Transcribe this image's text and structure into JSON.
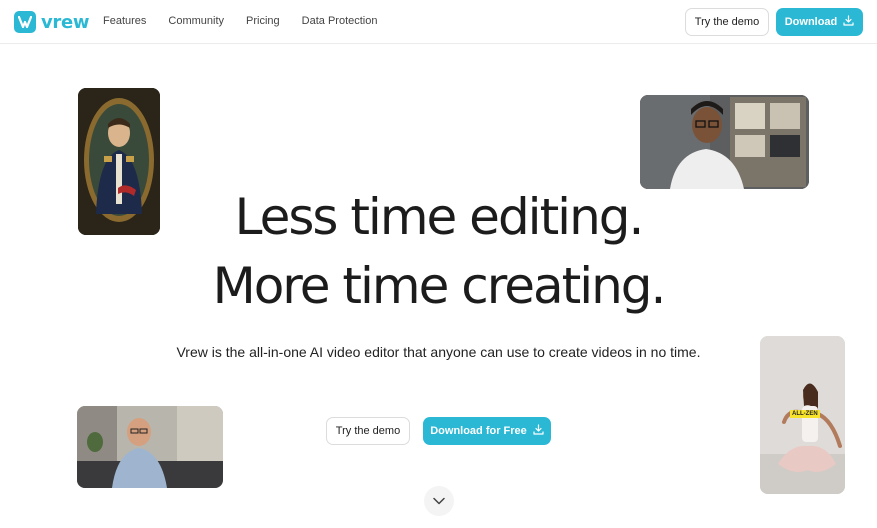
{
  "header": {
    "logo_text": "vrew",
    "nav": [
      "Features",
      "Community",
      "Pricing",
      "Data Protection"
    ],
    "try_demo_label": "Try the demo",
    "download_label": "Download"
  },
  "hero": {
    "headline_line1": "Less time editing.",
    "headline_line2": "More time creating.",
    "subtitle": "Vrew is the all-in-one AI video editor that anyone can use to create videos in no time.",
    "try_demo_label": "Try the demo",
    "download_free_label": "Download for Free"
  },
  "thumbnails": {
    "caption_text": "ALL-ZEN"
  },
  "colors": {
    "accent": "#2bb8d4",
    "text": "#1c1c1c",
    "border": "#dcdcdc"
  },
  "icons": {
    "logo": "vrew-logo-icon",
    "download": "download-icon",
    "scroll": "chevron-down-icon"
  }
}
